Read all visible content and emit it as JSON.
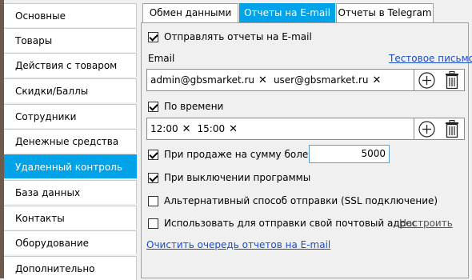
{
  "sidebar": {
    "items": [
      {
        "label": "Основные"
      },
      {
        "label": "Товары"
      },
      {
        "label": "Действия с товаром"
      },
      {
        "label": "Скидки/Баллы"
      },
      {
        "label": "Сотрудники"
      },
      {
        "label": "Денежные средства"
      },
      {
        "label": "Удаленный контроль"
      },
      {
        "label": "База данных"
      },
      {
        "label": "Контакты"
      },
      {
        "label": "Оборудование"
      },
      {
        "label": "Дополнительно"
      }
    ],
    "active_index": 6
  },
  "tabs": [
    {
      "label": "Обмен данными"
    },
    {
      "label": "Отчеты на E-mail"
    },
    {
      "label": "Отчеты в Telegram"
    }
  ],
  "email_tab": {
    "send_reports": {
      "label": "Отправлять отчеты на E-mail",
      "checked": true
    },
    "email_label": "Email",
    "test_email_link": "Тестовое письмо",
    "emails": [
      "admin@gbsmarket.ru",
      "user@gbsmarket.ru"
    ],
    "by_time": {
      "label": "По времени",
      "checked": true
    },
    "times": [
      "12:00",
      "15:00"
    ],
    "on_sale_over": {
      "label": "При продаже на сумму более",
      "checked": true,
      "amount": "5000"
    },
    "on_shutdown": {
      "label": "При выключении программы",
      "checked": true
    },
    "alt_send": {
      "label": "Альтернативный способ отправки (SSL подключение)",
      "checked": false
    },
    "own_mail": {
      "label": "Использовать для отправки свой почтовый адрес",
      "checked": false
    },
    "configure_link": "Настроить",
    "clear_queue_link": "Очистить очередь отчетов на E-mail"
  },
  "colors": {
    "accent": "#00a2e8",
    "link": "#1a4dc8"
  }
}
